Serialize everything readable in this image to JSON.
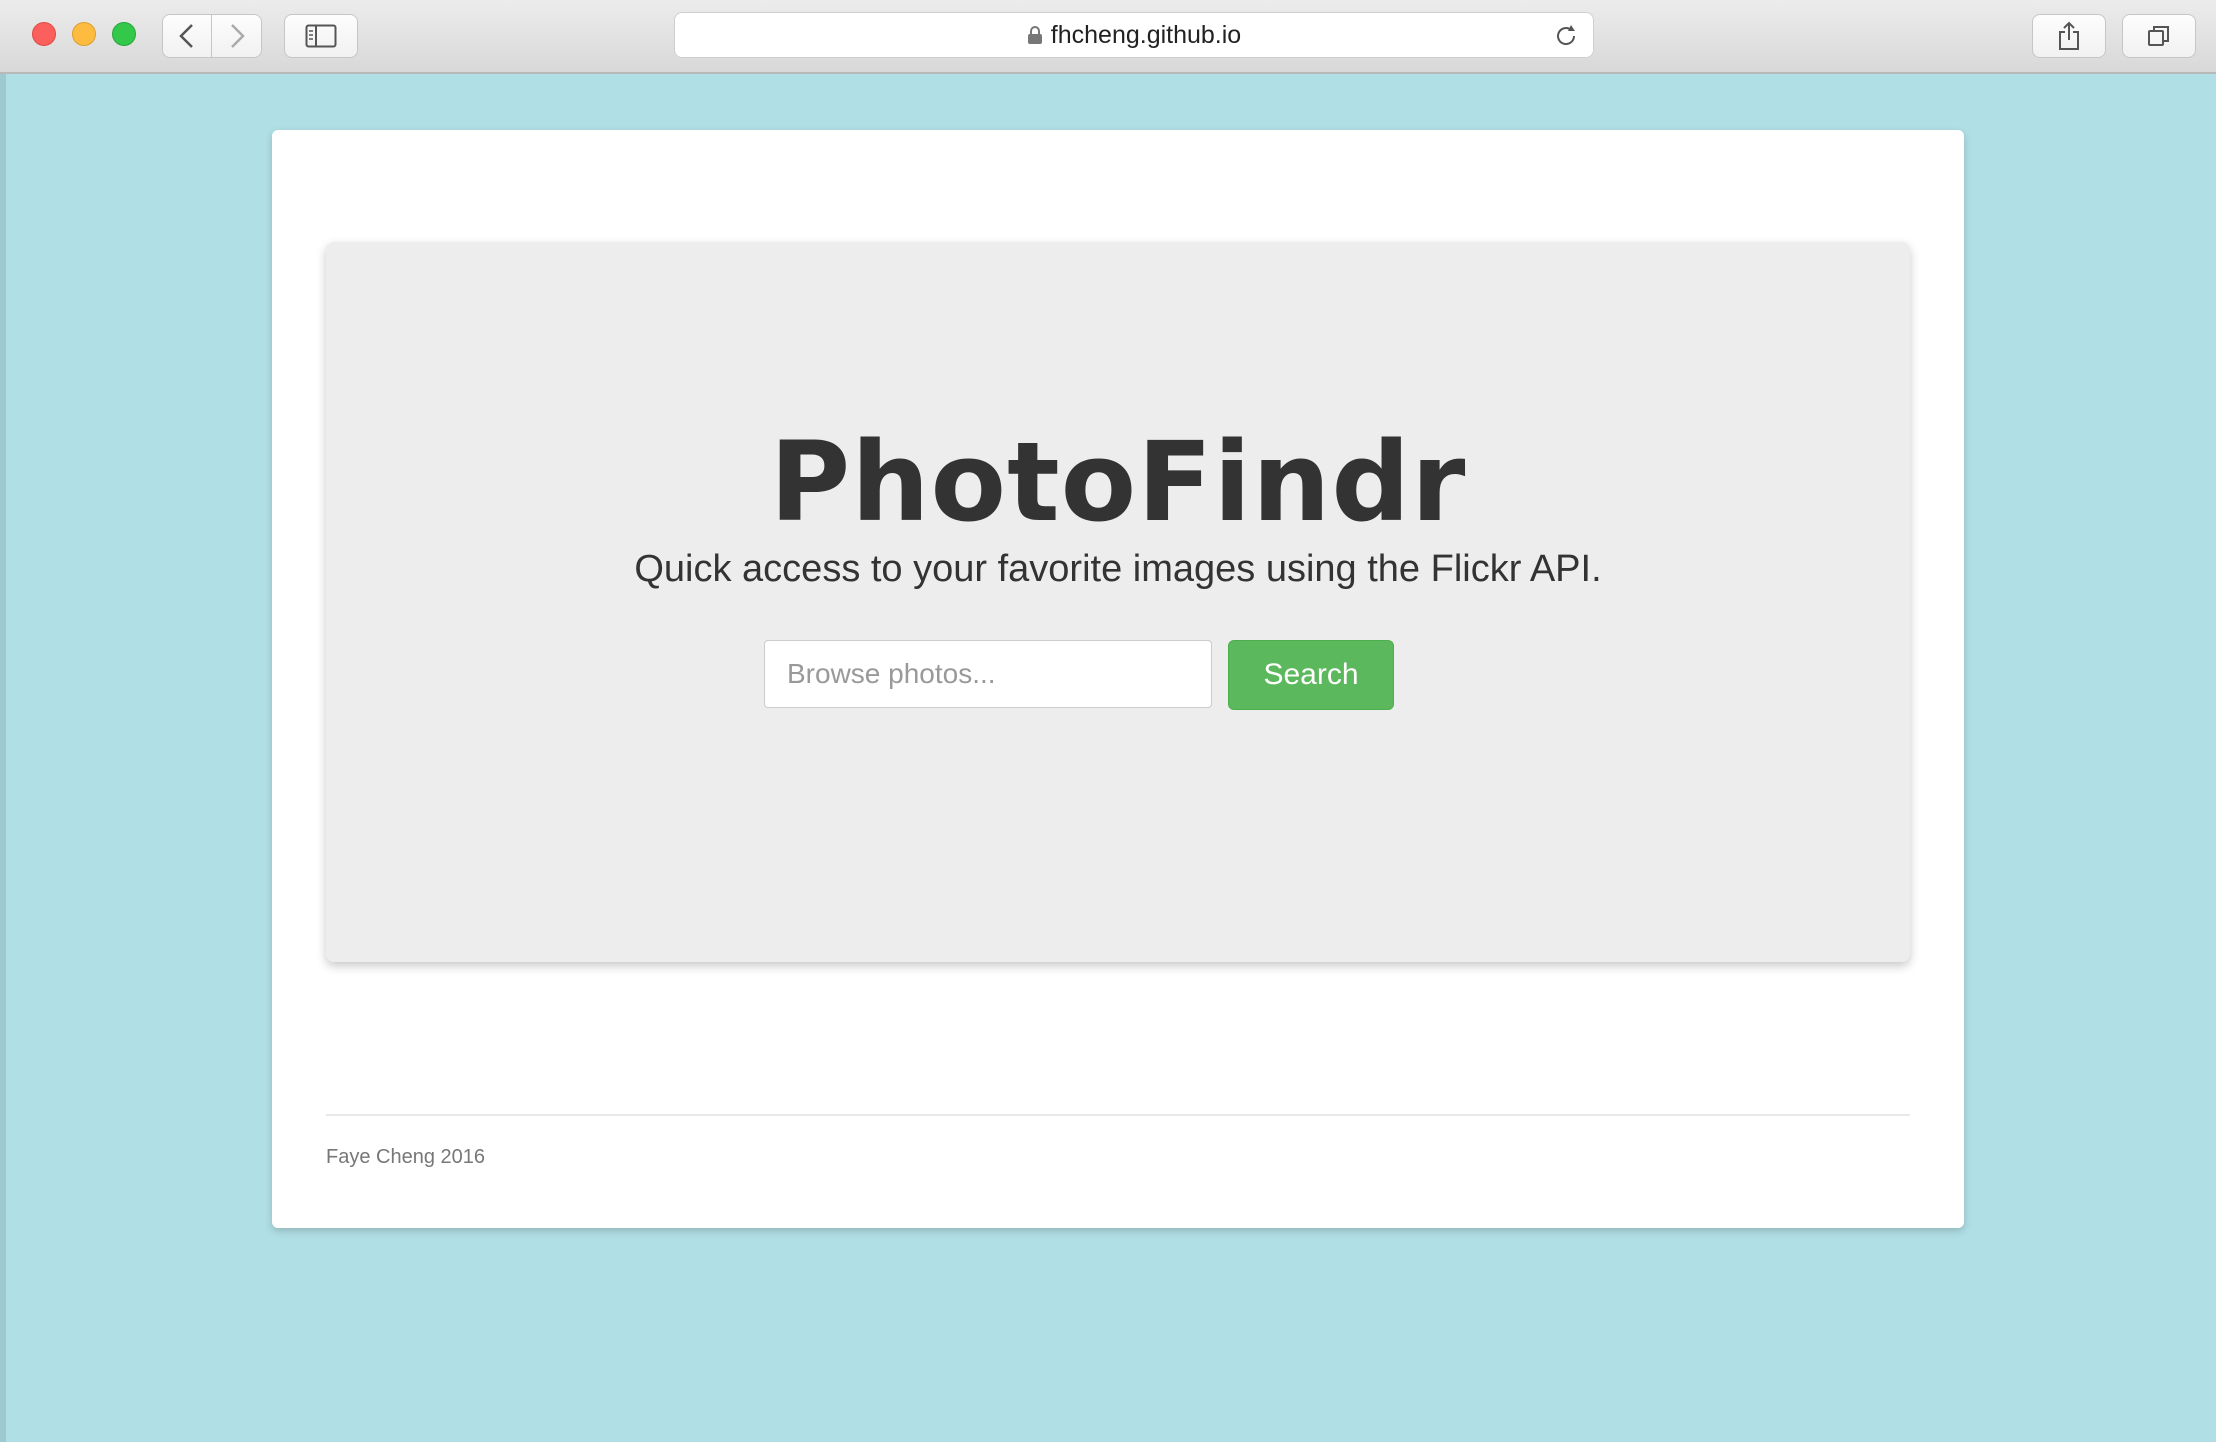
{
  "browser": {
    "url": "fhcheng.github.io",
    "secure": true
  },
  "page": {
    "title": "PhotoFindr",
    "subtitle": "Quick access to your favorite images using the Flickr API.",
    "search": {
      "placeholder": "Browse photos...",
      "value": "",
      "button_label": "Search"
    },
    "footer": "Faye Cheng 2016"
  },
  "colors": {
    "background": "#b0dfe5",
    "jumbotron": "#ededed",
    "button": "#5cb85c",
    "title": "#333333"
  }
}
